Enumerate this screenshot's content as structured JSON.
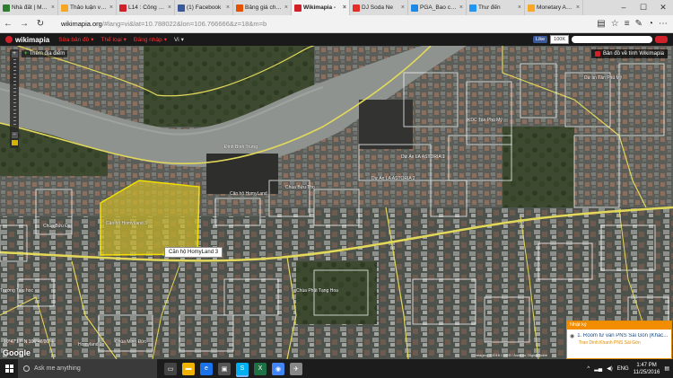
{
  "browser": {
    "tabs": [
      {
        "label": "Nhà đất | Mua b",
        "color": "#2e7d32",
        "active": false
      },
      {
        "label": "Thảo luận về cá",
        "color": "#f5a623",
        "active": false
      },
      {
        "label": "L14 : Công ty cổ",
        "color": "#d0202a",
        "active": false
      },
      {
        "label": "(1) Facebook",
        "color": "#3b5998",
        "active": false
      },
      {
        "label": "Bảng giá chứng",
        "color": "#e65100",
        "active": false
      },
      {
        "label": "Wikimapia -",
        "color": "#d0202a",
        "active": true
      },
      {
        "label": "DJ Soda Ne",
        "color": "#e52d27",
        "active": false
      },
      {
        "label": "PGA_Bao cao ai",
        "color": "#1e88e5",
        "active": false
      },
      {
        "label": "Thư đến",
        "color": "#2196f3",
        "active": false
      },
      {
        "label": "Monetary Autho",
        "color": "#f9a825",
        "active": false
      }
    ],
    "url_host": "wikimapia.org",
    "url_rest": "/#lang=vi&lat=10.788022&lon=106.766666&z=18&m=b"
  },
  "wikimapia": {
    "logo": "wikimapia",
    "menu": [
      {
        "label": "Sửa bản đồ",
        "style": "red"
      },
      {
        "label": "Thể loại",
        "style": "red"
      },
      {
        "label": "Đăng nhập",
        "style": "red"
      },
      {
        "label": "Vi",
        "style": "white"
      }
    ],
    "fb_like": "Like",
    "fb_count": "100K",
    "add_place": "Thêm địa điểm",
    "map_owner": "Bản đồ về tính Wikimapia"
  },
  "map": {
    "labels": [
      {
        "text": "Căn hộ HomyLand 3",
        "cls": "a"
      },
      {
        "text": "Căn hộ HomyLand",
        "cls": "b"
      },
      {
        "text": "Dự Án LA ASTORIA 1",
        "cls": "c"
      },
      {
        "text": "Dự Án LA ASTORIA 2",
        "cls": "d"
      },
      {
        "text": "KDC Tân Phú Mỹ",
        "cls": "e"
      },
      {
        "text": "Dự án Tân Phú Mỹ",
        "cls": "f"
      },
      {
        "text": "Chùa Phật Tạng Hoa",
        "cls": "g"
      },
      {
        "text": "Chùa Bửu Thọ",
        "cls": "h"
      },
      {
        "text": "Trường Tiểu học",
        "cls": "i"
      },
      {
        "text": "Homyland 2",
        "cls": "j"
      },
      {
        "text": "Chùa Minh Đức",
        "cls": "k"
      },
      {
        "text": "Chùa Bửu Đà",
        "cls": "l"
      },
      {
        "text": "Đình Bình Trưng",
        "cls": "m"
      }
    ],
    "tooltip": "Căn hộ HomyLand 3",
    "coords": "10°47'17\" N 106°46'00\" E",
    "google": "Google",
    "copyright": "Imagery ©2016 CNES / Astrium, DigitalGlobe"
  },
  "notification": {
    "header": "Nhật ký",
    "title": "1. Room tư vấn PNS Sài Gòn (Khác...",
    "subtitle": "Tran Dinh Khanh PNS Sài Gòn"
  },
  "taskbar": {
    "search_placeholder": "Ask me anything",
    "apps": [
      {
        "name": "task-view",
        "color": "#444",
        "glyph": "▭",
        "active": false
      },
      {
        "name": "file-explorer",
        "color": "#f0b400",
        "glyph": "▬",
        "active": false
      },
      {
        "name": "edge",
        "color": "#1a73e8",
        "glyph": "e",
        "active": false
      },
      {
        "name": "store",
        "color": "#555",
        "glyph": "▣",
        "active": false
      },
      {
        "name": "skype",
        "color": "#00aff0",
        "glyph": "S",
        "active": true
      },
      {
        "name": "excel",
        "color": "#1e7145",
        "glyph": "X",
        "active": false
      },
      {
        "name": "chrome",
        "color": "#4285f4",
        "glyph": "◉",
        "active": false
      },
      {
        "name": "app8",
        "color": "#888",
        "glyph": "✈",
        "active": false
      }
    ],
    "lang": "ENG",
    "time": "1:47 PM",
    "date": "11/25/2016"
  }
}
